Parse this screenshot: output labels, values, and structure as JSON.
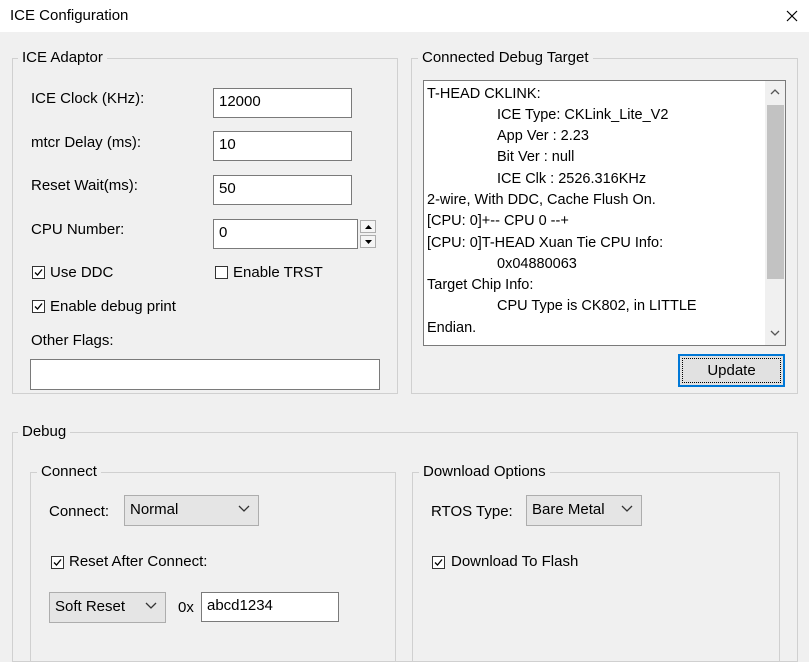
{
  "window": {
    "title": "ICE Configuration"
  },
  "ice_adaptor": {
    "group_label": "ICE Adaptor",
    "ice_clock_label": "ICE Clock (KHz):",
    "ice_clock_value": "12000",
    "mtcr_delay_label": "mtcr Delay (ms):",
    "mtcr_delay_value": "10",
    "reset_wait_label": "Reset Wait(ms):",
    "reset_wait_value": "50",
    "cpu_number_label": "CPU Number:",
    "cpu_number_value": "0",
    "use_ddc_label": "Use DDC",
    "use_ddc_checked": true,
    "enable_trst_label": "Enable TRST",
    "enable_trst_checked": false,
    "enable_debug_print_label": "Enable debug print",
    "enable_debug_print_checked": true,
    "other_flags_label": "Other Flags:",
    "other_flags_value": ""
  },
  "debug_target": {
    "group_label": "Connected Debug Target",
    "lines": [
      "T-HEAD CKLINK:",
      "ICE Type: CKLink_Lite_V2",
      "App Ver : 2.23",
      "Bit Ver : null",
      "ICE Clk : 2526.316KHz",
      "2-wire, With DDC, Cache Flush On.",
      "[CPU: 0]+--  CPU 0  --+",
      "[CPU: 0]T-HEAD Xuan Tie CPU Info:",
      "0x04880063",
      "Target Chip Info:",
      "CPU Type is CK802, in LITTLE",
      "Endian."
    ],
    "update_label": "Update"
  },
  "debug": {
    "group_label": "Debug",
    "connect": {
      "group_label": "Connect",
      "connect_label": "Connect:",
      "connect_value": "Normal",
      "reset_after_connect_label": "Reset After Connect:",
      "reset_after_connect_checked": true,
      "reset_type_value": "Soft Reset",
      "hex_prefix": "0x",
      "reset_address_value": "abcd1234"
    },
    "download": {
      "group_label": "Download Options",
      "rtos_label": "RTOS Type:",
      "rtos_value": "Bare Metal",
      "download_to_flash_label": "Download To Flash",
      "download_to_flash_checked": true
    }
  }
}
